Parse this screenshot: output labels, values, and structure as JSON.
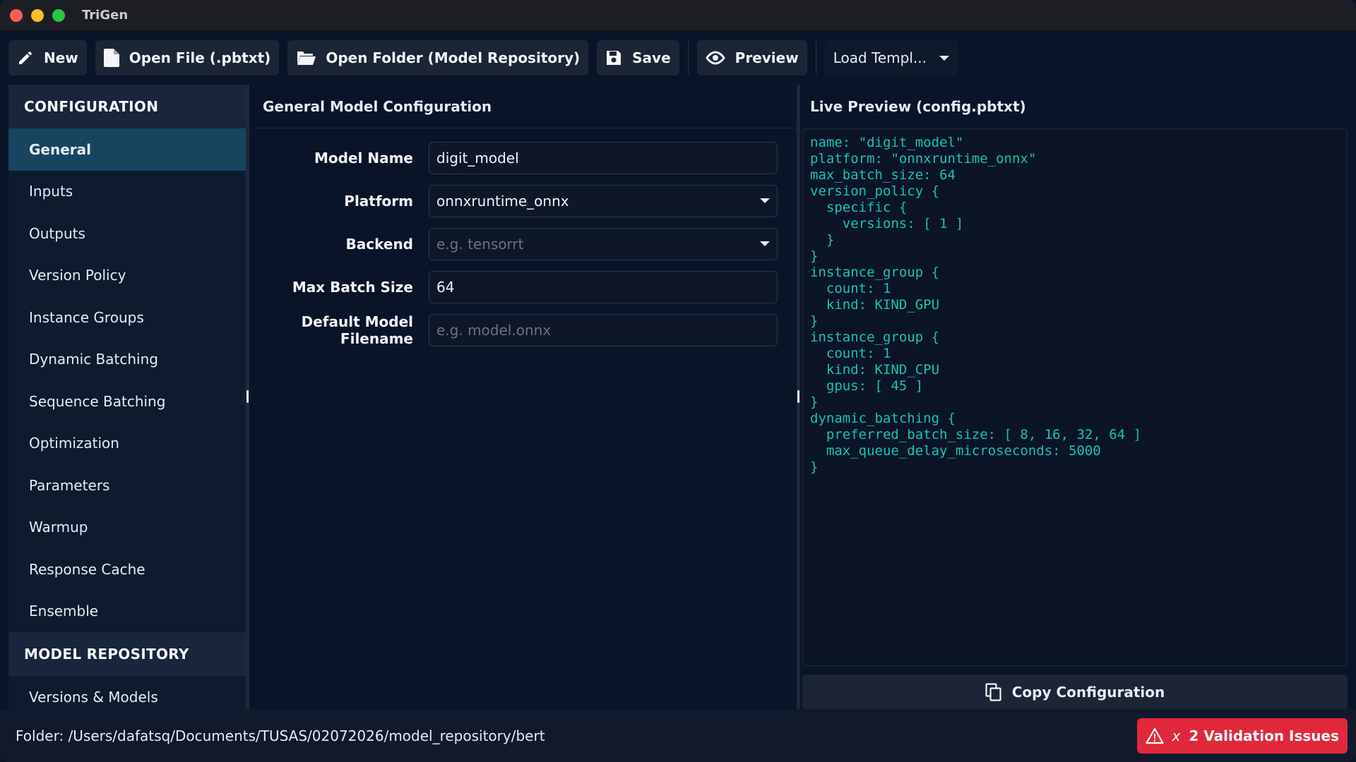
{
  "window": {
    "title": "TriGen"
  },
  "toolbar": {
    "new_label": "New",
    "open_file_label": "Open File (.pbtxt)",
    "open_folder_label": "Open Folder (Model Repository)",
    "save_label": "Save",
    "preview_label": "Preview",
    "load_template_label": "Load Templ..."
  },
  "sidebar": {
    "config_header": "CONFIGURATION",
    "items": [
      {
        "label": "General"
      },
      {
        "label": "Inputs"
      },
      {
        "label": "Outputs"
      },
      {
        "label": "Version Policy"
      },
      {
        "label": "Instance Groups"
      },
      {
        "label": "Dynamic Batching"
      },
      {
        "label": "Sequence Batching"
      },
      {
        "label": "Optimization"
      },
      {
        "label": "Parameters"
      },
      {
        "label": "Warmup"
      },
      {
        "label": "Response Cache"
      },
      {
        "label": "Ensemble"
      }
    ],
    "repo_header": "MODEL REPOSITORY",
    "repo_items": [
      {
        "label": "Versions & Models"
      }
    ]
  },
  "form": {
    "title": "General Model Configuration",
    "model_name": {
      "label": "Model Name",
      "value": "digit_model"
    },
    "platform": {
      "label": "Platform",
      "value": "onnxruntime_onnx"
    },
    "backend": {
      "label": "Backend",
      "placeholder": "e.g. tensorrt"
    },
    "max_batch_size": {
      "label": "Max Batch Size",
      "value": "64"
    },
    "default_model_filename": {
      "label": "Default Model Filename",
      "placeholder": "e.g. model.onnx"
    }
  },
  "preview": {
    "title": "Live Preview (config.pbtxt)",
    "code": "name: \"digit_model\"\nplatform: \"onnxruntime_onnx\"\nmax_batch_size: 64\nversion_policy {\n  specific {\n    versions: [ 1 ]\n  }\n}\ninstance_group {\n  count: 1\n  kind: KIND_GPU\n}\ninstance_group {\n  count: 1\n  kind: KIND_CPU\n  gpus: [ 45 ]\n}\ndynamic_batching {\n  preferred_batch_size: [ 8, 16, 32, 64 ]\n  max_queue_delay_microseconds: 5000\n}",
    "copy_label": "Copy Configuration"
  },
  "status": {
    "folder_text": "Folder: /Users/dafatsq/Documents/TUSAS/02072026/model_repository/bert",
    "validation_prefix": "x",
    "validation_text": "2 Validation Issues"
  },
  "colors": {
    "background": "#0a1428",
    "accent_active": "#174560",
    "code_text": "#17c3b2",
    "error": "#e0283b"
  }
}
